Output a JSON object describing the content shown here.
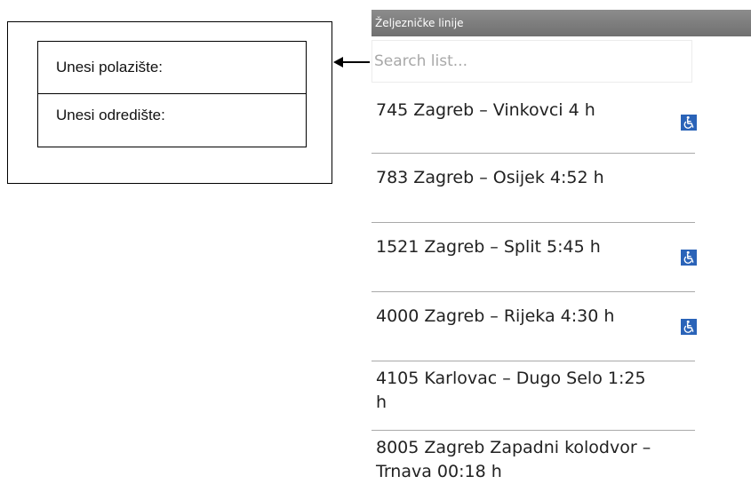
{
  "form": {
    "origin_label": "Unesi polazište:",
    "destination_label": "Unesi odredište:"
  },
  "mockup": {
    "header_title": "Željezničke linije",
    "search_placeholder": "Search list...",
    "routes": [
      {
        "text": "745 Zagreb – Vinkovci 4 h",
        "accessible": true
      },
      {
        "text": "783 Zagreb – Osijek 4:52 h",
        "accessible": false
      },
      {
        "text": "1521 Zagreb – Split 5:45 h",
        "accessible": true
      },
      {
        "text": "4000 Zagreb – Rijeka 4:30 h",
        "accessible": true
      },
      {
        "text": "4105 Karlovac – Dugo Selo 1:25 h",
        "accessible": false
      },
      {
        "text": "8005 Zagreb Zapadni kolodvor – Trnava 00:18 h",
        "accessible": false
      }
    ],
    "icons": {
      "accessibility": "wheelchair-icon",
      "arrow": "arrow-left-icon"
    },
    "colors": {
      "header_bg": "#7a7a7a",
      "accessibility_icon": "#2a63b8",
      "divider": "#a9a9a9"
    }
  }
}
